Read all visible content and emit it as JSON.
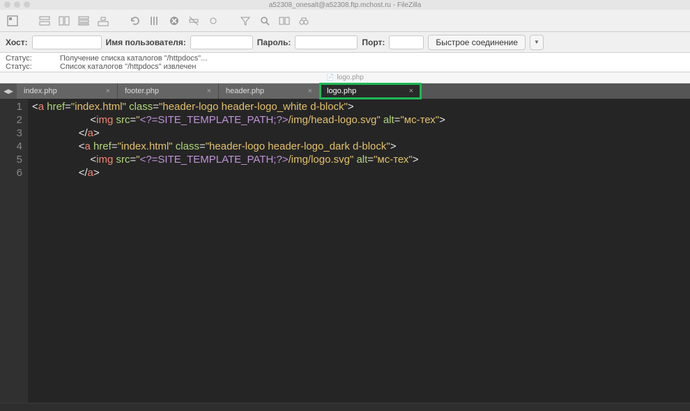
{
  "window": {
    "title": "a52308_onesalt@a52308.ftp.mchost.ru - FileZilla"
  },
  "conn": {
    "host_label": "Хост:",
    "host_value": "",
    "user_label": "Имя пользователя:",
    "user_value": "",
    "pass_label": "Пароль:",
    "pass_value": "",
    "port_label": "Порт:",
    "port_value": "",
    "quick_label": "Быстрое соединение"
  },
  "log": {
    "status_label": "Статус:",
    "line1": "Получение списка каталогов \"/httpdocs\"...",
    "line2": "Список каталогов \"/httpdocs\" извлечен"
  },
  "editor_header": {
    "filename": "logo.php"
  },
  "tabs": [
    {
      "label": "index.php"
    },
    {
      "label": "footer.php"
    },
    {
      "label": "header.php"
    },
    {
      "label": "logo.php",
      "active": true
    }
  ],
  "code_lines": [
    {
      "n": "1",
      "indent": 0,
      "tokens": [
        {
          "t": "tag",
          "v": "<"
        },
        {
          "t": "name",
          "v": "a"
        },
        {
          "t": "tag",
          "v": " "
        },
        {
          "t": "attr",
          "v": "href"
        },
        {
          "t": "op",
          "v": "="
        },
        {
          "t": "str",
          "v": "\"index.html\""
        },
        {
          "t": "tag",
          "v": " "
        },
        {
          "t": "attr",
          "v": "class"
        },
        {
          "t": "op",
          "v": "="
        },
        {
          "t": "str",
          "v": "\"header-logo header-logo_white d-block\""
        },
        {
          "t": "tag",
          "v": ">"
        }
      ]
    },
    {
      "n": "2",
      "indent": 20,
      "tokens": [
        {
          "t": "tag",
          "v": "<"
        },
        {
          "t": "name",
          "v": "img"
        },
        {
          "t": "tag",
          "v": " "
        },
        {
          "t": "attr",
          "v": "src"
        },
        {
          "t": "op",
          "v": "="
        },
        {
          "t": "str",
          "v": "\""
        },
        {
          "t": "php",
          "v": "<?=SITE_TEMPLATE_PATH;?>"
        },
        {
          "t": "str",
          "v": "/img/head-logo.svg\""
        },
        {
          "t": "tag",
          "v": " "
        },
        {
          "t": "attr",
          "v": "alt"
        },
        {
          "t": "op",
          "v": "="
        },
        {
          "t": "str",
          "v": "\"мс-тех\""
        },
        {
          "t": "tag",
          "v": ">"
        }
      ]
    },
    {
      "n": "3",
      "indent": 16,
      "tokens": [
        {
          "t": "tag",
          "v": "</"
        },
        {
          "t": "name",
          "v": "a"
        },
        {
          "t": "tag",
          "v": ">"
        }
      ]
    },
    {
      "n": "4",
      "indent": 16,
      "tokens": [
        {
          "t": "tag",
          "v": "<"
        },
        {
          "t": "name",
          "v": "a"
        },
        {
          "t": "tag",
          "v": " "
        },
        {
          "t": "attr",
          "v": "href"
        },
        {
          "t": "op",
          "v": "="
        },
        {
          "t": "str",
          "v": "\"index.html\""
        },
        {
          "t": "tag",
          "v": " "
        },
        {
          "t": "attr",
          "v": "class"
        },
        {
          "t": "op",
          "v": "="
        },
        {
          "t": "str",
          "v": "\"header-logo header-logo_dark d-block\""
        },
        {
          "t": "tag",
          "v": ">"
        }
      ]
    },
    {
      "n": "5",
      "indent": 20,
      "tokens": [
        {
          "t": "tag",
          "v": "<"
        },
        {
          "t": "name",
          "v": "img"
        },
        {
          "t": "tag",
          "v": " "
        },
        {
          "t": "attr",
          "v": "src"
        },
        {
          "t": "op",
          "v": "="
        },
        {
          "t": "str",
          "v": "\""
        },
        {
          "t": "php",
          "v": "<?=SITE_TEMPLATE_PATH;?>"
        },
        {
          "t": "str",
          "v": "/img/logo.svg\""
        },
        {
          "t": "tag",
          "v": " "
        },
        {
          "t": "attr",
          "v": "alt"
        },
        {
          "t": "op",
          "v": "="
        },
        {
          "t": "str",
          "v": "\"мс-тех\""
        },
        {
          "t": "tag",
          "v": ">"
        }
      ]
    },
    {
      "n": "6",
      "indent": 16,
      "tokens": [
        {
          "t": "tag",
          "v": "</"
        },
        {
          "t": "name",
          "v": "a"
        },
        {
          "t": "tag",
          "v": ">"
        }
      ]
    }
  ]
}
